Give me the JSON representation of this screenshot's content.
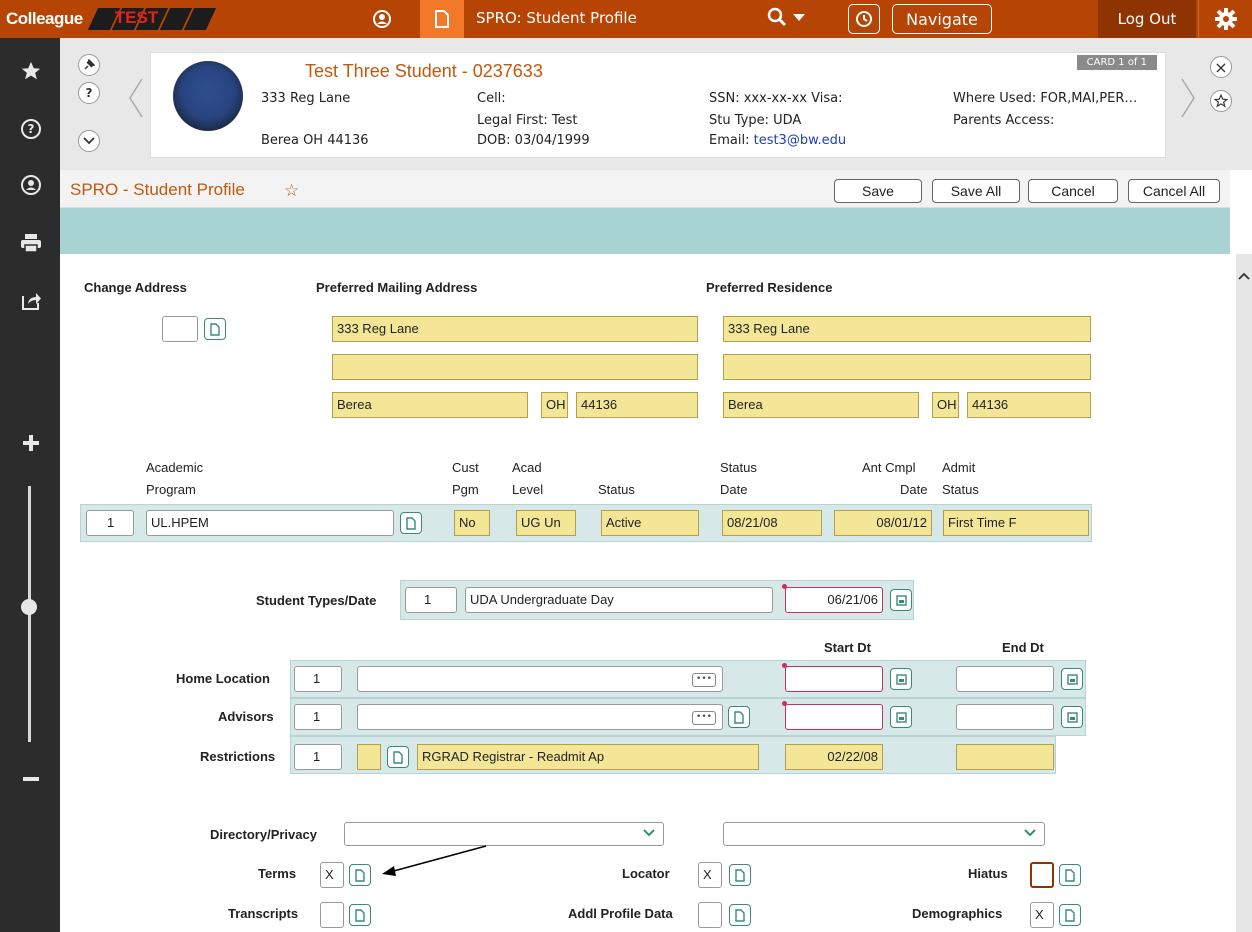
{
  "topbar": {
    "logo": "Colleague",
    "env": "TEST",
    "screen_title": "SPRO: Student Profile",
    "navigate": "Navigate",
    "logout": "Log Out"
  },
  "card": {
    "name": "Test Three Student  -  0237633",
    "badge": "CARD 1 of 1",
    "address1": "333 Reg Lane",
    "address2": "Berea OH 44136",
    "cell": "Cell:",
    "legal_first": "Legal First: Test",
    "dob": "DOB: 03/04/1999",
    "ssn": "SSN: xxx-xx-xx Visa:",
    "stu_type": "Stu Type: UDA",
    "email_label": "Email: ",
    "email": "test3@bw.edu",
    "where_used": "Where Used: FOR,MAI,PER…",
    "parents_access": "Parents Access:"
  },
  "titlebar": {
    "title": "SPRO - Student Profile",
    "save": "Save",
    "save_all": "Save All",
    "cancel": "Cancel",
    "cancel_all": "Cancel All"
  },
  "address": {
    "change_address_label": "Change Address",
    "pref_mailing_label": "Preferred Mailing Address",
    "pref_residence_label": "Preferred Residence",
    "mail_line1": "333 Reg Lane",
    "mail_line2": "",
    "mail_city": "Berea",
    "mail_state": "OH",
    "mail_zip": "44136",
    "res_line1": "333 Reg Lane",
    "res_line2": "",
    "res_city": "Berea",
    "res_state": "OH",
    "res_zip": "44136"
  },
  "program": {
    "headers": {
      "academic": "Academic",
      "program": "Program",
      "cust": "Cust",
      "pgm": "Pgm",
      "acad": "Acad",
      "level": "Level",
      "status": "Status",
      "status_date_1": "Status",
      "status_date_2": "Date",
      "ant_cmpl_1": "Ant Cmpl",
      "ant_cmpl_2": "Date",
      "admit_1": "Admit",
      "admit_2": "Status"
    },
    "row": {
      "num": "1",
      "program": "UL.HPEM",
      "cust_pgm": "No",
      "level": "UG Un",
      "status": "Active",
      "status_date": "08/21/08",
      "ant_cmpl": "08/01/12",
      "admit_status": "First Time F"
    }
  },
  "student_types": {
    "label": "Student Types/Date",
    "num": "1",
    "value": "UDA Undergraduate Day",
    "date": "06/21/06"
  },
  "locations": {
    "start_dt_label": "Start Dt",
    "end_dt_label": "End Dt",
    "home_location_label": "Home Location",
    "home_num": "1",
    "advisors_label": "Advisors",
    "advisors_num": "1",
    "restrictions_label": "Restrictions",
    "restrictions_num": "1",
    "restriction_value": "RGRAD Registrar - Readmit Ap",
    "restriction_start": "02/22/08"
  },
  "bottom": {
    "directory_privacy_label": "Directory/Privacy",
    "terms_label": "Terms",
    "terms_value": "X",
    "locator_label": "Locator",
    "locator_value": "X",
    "hiatus_label": "Hiatus",
    "transcripts_label": "Transcripts",
    "addl_profile_label": "Addl Profile Data",
    "demographics_label": "Demographics",
    "demographics_value": "X"
  },
  "colors": {
    "brand": "#b64405",
    "title_accent": "#c2590f",
    "field_yellow": "#f3e797",
    "row_teal": "#d6e8e8"
  }
}
